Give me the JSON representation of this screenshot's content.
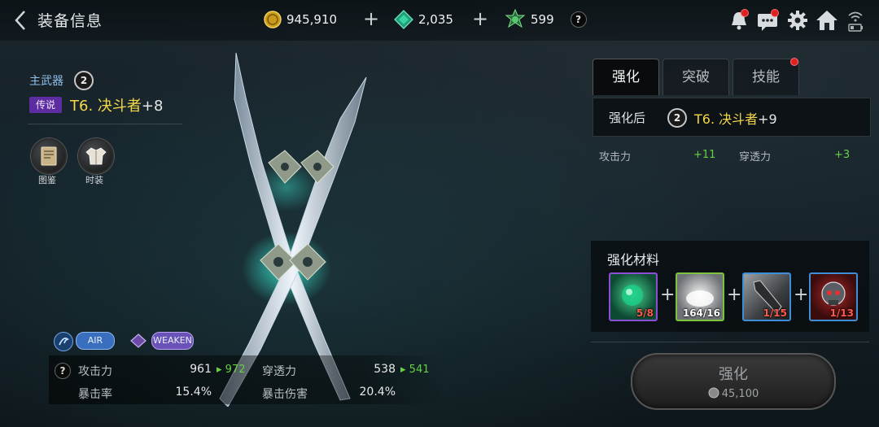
{
  "header": {
    "title": "装备信息",
    "currency": [
      {
        "name": "gold",
        "value": "945,910"
      },
      {
        "name": "gem",
        "value": "2,035"
      },
      {
        "name": "token",
        "value": "599"
      }
    ],
    "help": "?"
  },
  "item": {
    "slot": "主武器",
    "grade": "2",
    "rarity": "传说",
    "name": "T6. 决斗者",
    "enhance": "+8",
    "actions": [
      {
        "label": "图鉴",
        "icon": "codex-icon"
      },
      {
        "label": "时装",
        "icon": "costume-icon"
      }
    ],
    "tags": [
      "AIR",
      "WEAKEN"
    ],
    "stats": {
      "help": "?",
      "attack_label": "攻击力",
      "attack_value": "961",
      "attack_next": "972",
      "pierce_label": "穿透力",
      "pierce_value": "538",
      "pierce_next": "541",
      "crit_rate_label": "暴击率",
      "crit_rate_value": "15.4%",
      "crit_dmg_label": "暴击伤害",
      "crit_dmg_value": "20.4%"
    }
  },
  "tabs": [
    {
      "label": "强化",
      "active": true
    },
    {
      "label": "突破",
      "active": false
    },
    {
      "label": "技能",
      "active": false,
      "notify": true
    }
  ],
  "result": {
    "label": "强化后",
    "grade": "2",
    "name": "T6. 决斗者",
    "enhance": "+9",
    "attack_label": "攻击力",
    "attack_gain": "+11",
    "pierce_label": "穿透力",
    "pierce_gain": "+3"
  },
  "materials": {
    "title": "强化材料",
    "items": [
      {
        "count": "5/8",
        "enough": false,
        "icon": "green-orb-icon",
        "border": "#8a4fd6"
      },
      {
        "count": "164/16",
        "enough": true,
        "icon": "powder-icon",
        "border": "#7bc43c"
      },
      {
        "count": "1/15",
        "enough": false,
        "icon": "weapon-part-icon",
        "border": "#3d8ed6"
      },
      {
        "count": "1/13",
        "enough": false,
        "icon": "skull-core-icon",
        "border": "#3d8ed6"
      }
    ],
    "plus": "+"
  },
  "action": {
    "label": "强化",
    "cost": "45,100"
  },
  "colors": {
    "name_gold": "#f5d84a",
    "rarity_purple": "#5d2ca0",
    "stat_up_green": "#66d144",
    "shortage_red": "#ff5a4a"
  }
}
